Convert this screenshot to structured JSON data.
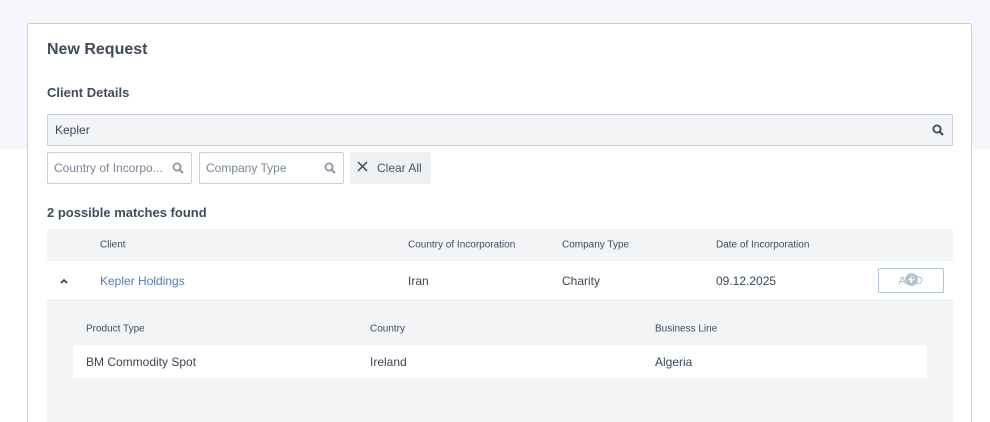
{
  "page": {
    "title": "New Request"
  },
  "client_details": {
    "heading": "Client Details",
    "search": {
      "value": "Kepler",
      "icon": "search-icon"
    },
    "filters": {
      "country_placeholder": "Country of Incorpo...",
      "company_type_placeholder": "Company Type",
      "clear_all_label": "Clear All"
    }
  },
  "results": {
    "summary": "2 possible matches found",
    "columns": {
      "client": "Client",
      "country": "Country of Incorporation",
      "company_type": "Company Type",
      "date": "Date of Incorporation"
    },
    "rows": [
      {
        "client": "Kepler Holdings",
        "country": "Iran",
        "company_type": "Charity",
        "date": "09.12.2025",
        "expanded": true,
        "add_label": "ADD",
        "products": {
          "columns": {
            "product_type": "Product Type",
            "country": "Country",
            "business_line": "Business Line"
          },
          "rows": [
            {
              "product_type": "BM Commodity Spot",
              "country": "Ireland",
              "business_line": "Algeria"
            }
          ]
        }
      }
    ]
  },
  "colors": {
    "link": "#4a7bc4",
    "border": "#c9d0db",
    "panel_bg": "#f3f4f6",
    "add_disabled": "#a9b6c7"
  }
}
